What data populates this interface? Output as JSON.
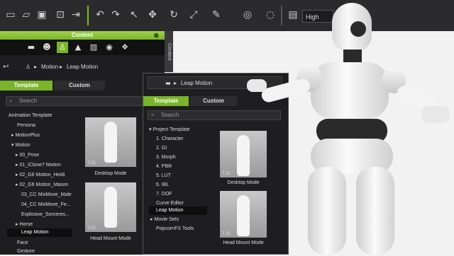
{
  "toolbar": {
    "icons": [
      "new-file-icon",
      "open-folder-icon",
      "save-icon",
      "import-icon",
      "export-icon",
      "undo-icon",
      "redo-icon",
      "select-icon",
      "move-icon",
      "rotate-icon",
      "pen-icon",
      "camera-icon",
      "layout-icon"
    ],
    "quality_value": "High"
  },
  "content_panel": {
    "title": "Content",
    "side_tab_label": "Content",
    "breadcrumb": [
      "Motion",
      "Leap Motion"
    ],
    "tabs": [
      {
        "label": "Template"
      },
      {
        "label": "Custom"
      }
    ],
    "search_placeholder": "Search",
    "tree": [
      {
        "label": "Animation Template"
      },
      {
        "label": "Persona"
      },
      {
        "label": "MotionPlus"
      },
      {
        "label": "Motion"
      },
      {
        "label": "00_Pose"
      },
      {
        "label": "01_iClone7 Motion"
      },
      {
        "label": "02_G6 Motion_Heidi"
      },
      {
        "label": "02_G6 Motion_Mason"
      },
      {
        "label": "03_CC MixMove_Male"
      },
      {
        "label": "04_CC MixMove_Fe..."
      },
      {
        "label": "Explosive_Sorceres..."
      },
      {
        "label": "Horse"
      },
      {
        "label": "Leap Motion"
      },
      {
        "label": "Face"
      },
      {
        "label": "Gesture"
      }
    ],
    "thumbs": [
      {
        "caption": "Desktop Mode",
        "badge": "7.21"
      },
      {
        "caption": "Head Mount Mode",
        "badge": "7.21"
      }
    ]
  },
  "popup_panel": {
    "breadcrumb": "Leap Motion",
    "tabs": [
      {
        "label": "Template"
      },
      {
        "label": "Custom"
      }
    ],
    "search_placeholder": "Search",
    "tree": [
      {
        "label": "Project Template"
      },
      {
        "label": "1. Character"
      },
      {
        "label": "2. GI"
      },
      {
        "label": "3. Morph"
      },
      {
        "label": "4. PBR"
      },
      {
        "label": "5. LUT"
      },
      {
        "label": "6. IBL"
      },
      {
        "label": "7. DOF"
      },
      {
        "label": "Curve Editor"
      },
      {
        "label": "Leap Motion"
      },
      {
        "label": "Movie Sets"
      },
      {
        "label": "PopcornFX Tools"
      }
    ],
    "thumbs": [
      {
        "caption": "Desktop Mode",
        "badge": "7.21"
      },
      {
        "caption": "Head Mount Mode",
        "badge": "7.21"
      }
    ]
  },
  "colors": {
    "accent": "#7ab42a",
    "panel_bg": "#1e1e20",
    "toolbar_bg": "#2b2b2d"
  }
}
